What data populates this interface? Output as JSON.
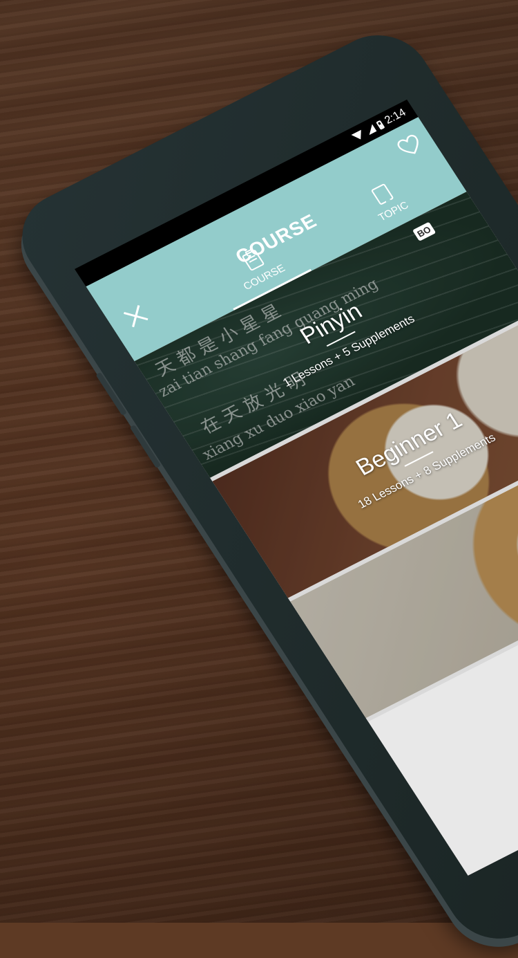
{
  "status_bar": {
    "time": "2:14"
  },
  "app_bar": {
    "title": "COURSE",
    "tabs": [
      {
        "label": "COURSE",
        "icon": "clipboard-icon",
        "active": true
      },
      {
        "label": "TOPIC",
        "icon": "bookmark-icon",
        "active": false
      }
    ],
    "close_icon": "close-icon",
    "favorite_icon": "heart-icon"
  },
  "courses": [
    {
      "title": "Pinyin",
      "subtitle": "1 Lessons + 5 Supplements",
      "badge": "BO",
      "chalk_lines": [
        "天 都 是 小 星 星",
        "zai tian shang fang guang ming",
        "在 天 放 光 明",
        "xiang xu duo xiao yan"
      ]
    },
    {
      "title": "Beginner 1",
      "subtitle": "18 Lessons + 8 Supplements"
    },
    {
      "title": "",
      "subtitle": ""
    }
  ],
  "colors": {
    "accent": "#93cccb",
    "phone_body": "#1e2a2c",
    "table_wood": "#5e3b27"
  }
}
